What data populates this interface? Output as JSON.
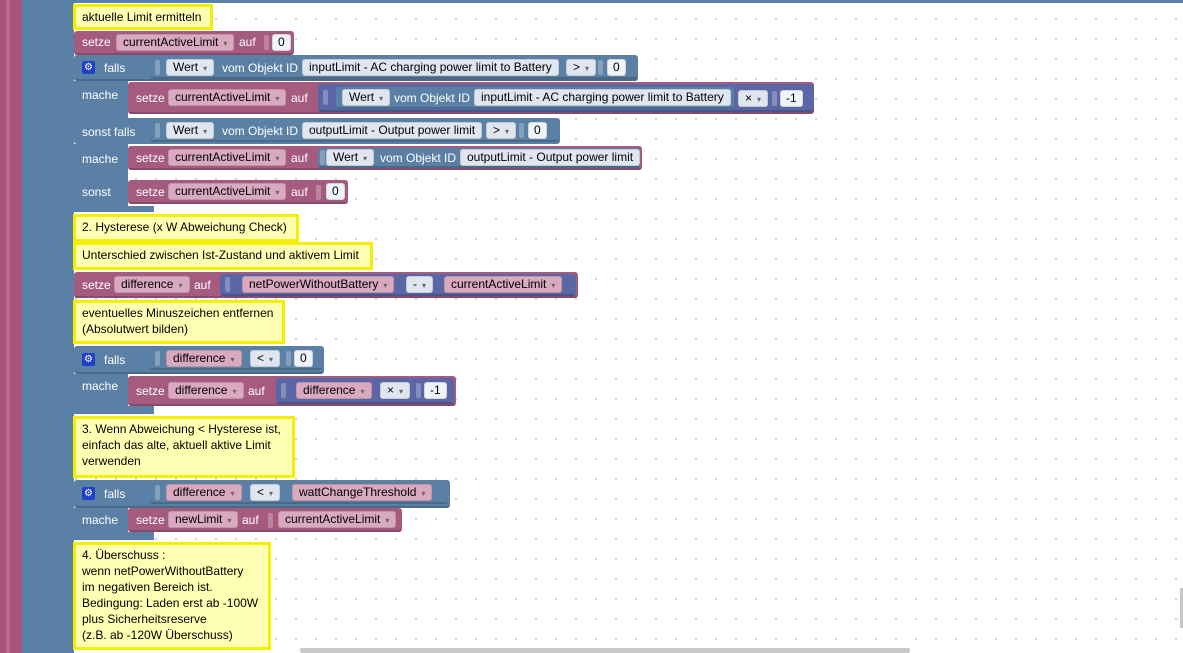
{
  "comments": {
    "c1": "aktuelle Limit ermitteln",
    "c2": "2. Hysterese (x W Abweichung Check)",
    "c3": "Unterschied zwischen Ist-Zustand und aktivem Limit",
    "c4": "eventuelles Minuszeichen entfernen\n(Absolutwert bilden)",
    "c5": "3. Wenn Abweichung < Hysterese ist,\neinfach das alte, aktuell aktive Limit\nverwenden",
    "c6": "4. Überschuss :\nwenn netPowerWithoutBattery\nim negativen Bereich ist.\nBedingung: Laden erst ab -100W\nplus Sicherheitsreserve\n(z.B. ab -120W Überschuss)"
  },
  "kw": {
    "setze": "setze",
    "auf": "auf",
    "falls": "falls",
    "mache": "mache",
    "sonst_falls": "sonst falls",
    "sonst": "sonst",
    "vom_objekt_id": "vom Objekt ID"
  },
  "vars": {
    "currentActiveLimit": "currentActiveLimit",
    "difference": "difference",
    "netPowerWithoutBattery": "netPowerWithoutBattery",
    "wattChangeThreshold": "wattChangeThreshold",
    "newLimit": "newLimit"
  },
  "fields": {
    "wert": "Wert",
    "input_limit": "inputLimit - AC charging power limit to Battery",
    "output_limit": "outputLimit - Output power limit"
  },
  "ops": {
    "gt": ">",
    "lt": "<",
    "times": "×",
    "minus": "-"
  },
  "nums": {
    "zero": "0",
    "minus_one": "-1"
  },
  "icons": {
    "gear": "⚙",
    "dropdown": "▾"
  }
}
